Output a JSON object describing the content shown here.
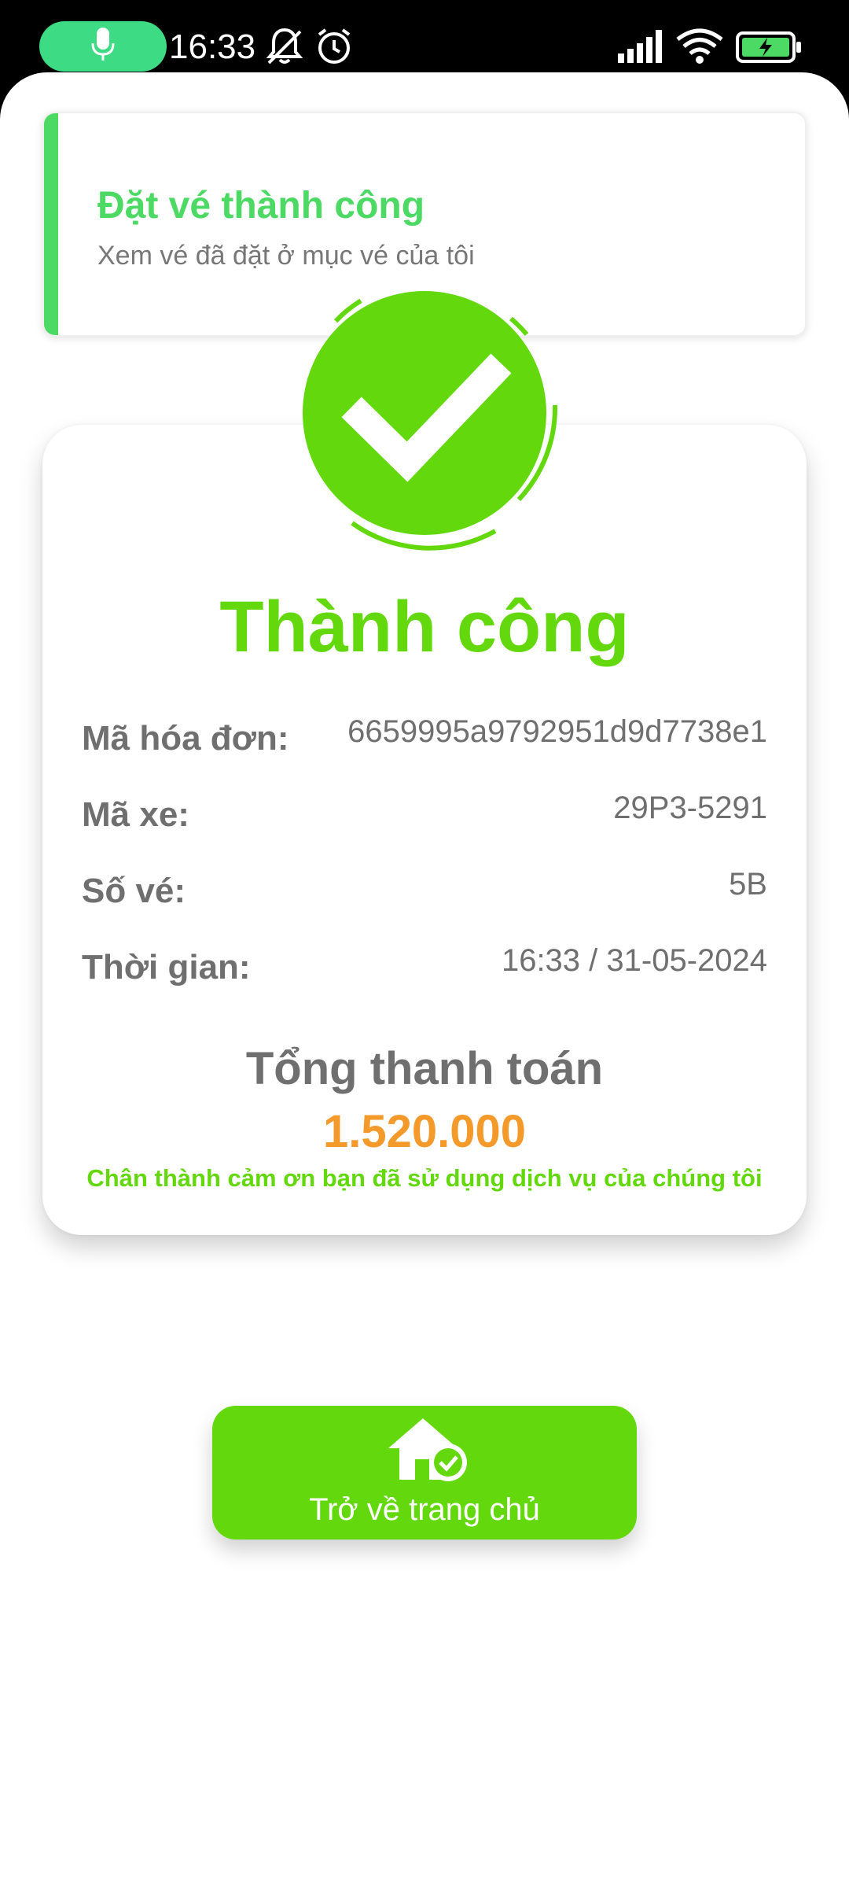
{
  "status_bar": {
    "time": "16:33",
    "icons": [
      "microphone-icon",
      "bell-off-icon",
      "alarm-icon",
      "signal-icon",
      "wifi-icon",
      "battery-charging-icon"
    ]
  },
  "toast": {
    "title": "Đặt vé thành công",
    "subtitle": "Xem vé đã đặt ở mục vé của tôi"
  },
  "success": {
    "title": "Thành công"
  },
  "details": [
    {
      "label": "Mã hóa đơn:",
      "value": "6659995a9792951d9d7738e1"
    },
    {
      "label": "Mã xe:",
      "value": "29P3-5291"
    },
    {
      "label": "Số vé:",
      "value": "5B"
    },
    {
      "label": "Thời gian:",
      "value": "16:33 / 31-05-2024"
    }
  ],
  "total": {
    "label": "Tổng thanh toán",
    "value": "1.520.000"
  },
  "thanks": "Chân thành cảm ơn bạn đã sử dụng dịch vụ của chúng tôi",
  "home_button": {
    "label": "Trở về trang chủ",
    "icon": "home-check-icon"
  },
  "colors": {
    "success_green": "#63d80d",
    "toast_green": "#4cd964",
    "amount_orange": "#f39a2b",
    "text_gray": "#6f6f6f"
  }
}
